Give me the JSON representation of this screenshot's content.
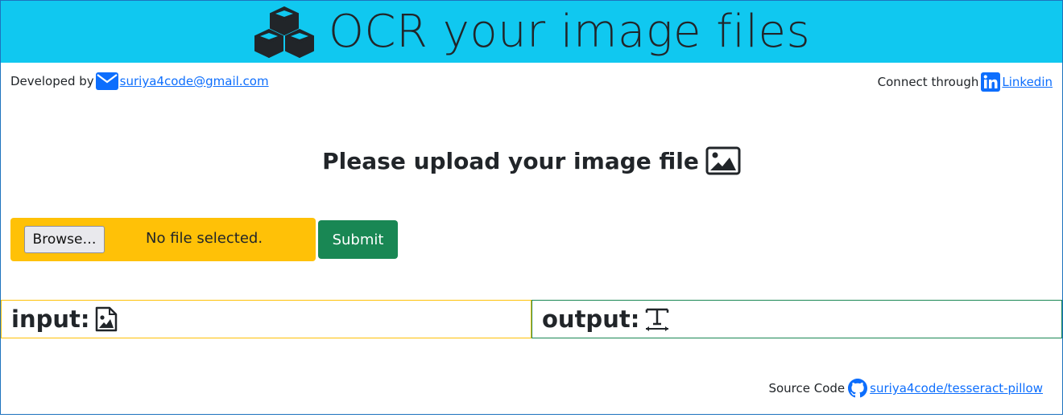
{
  "header": {
    "title": "OCR your image files",
    "icon": "cubes-icon",
    "background": "#10c8f0"
  },
  "developer": {
    "label": "Developed by",
    "email": "suriya4code@gmail.com",
    "icon": "envelope-icon"
  },
  "connect": {
    "label": "Connect through",
    "link_text": "Linkedin",
    "icon": "linkedin-icon"
  },
  "upload": {
    "heading": "Please upload your image file",
    "icon": "image-icon",
    "browse_label": "Browse…",
    "file_status": "No file selected.",
    "submit_label": "Submit",
    "zone_color": "#ffc107",
    "submit_color": "#198754"
  },
  "panels": {
    "input_label": "input:",
    "input_icon": "file-image-icon",
    "output_label": "output:",
    "output_icon": "text-icon"
  },
  "footer": {
    "label": "Source Code",
    "repo_link": "suriya4code/tesseract-pillow",
    "icon": "github-icon"
  }
}
